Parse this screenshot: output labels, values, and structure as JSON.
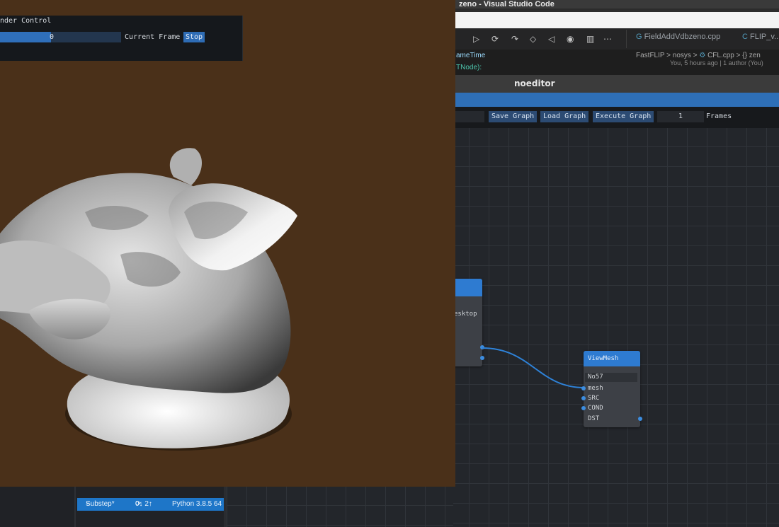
{
  "vscode": {
    "title": "zeno - Visual Studio Code",
    "tabs": [
      "FieldAddVdbzeno.cpp",
      "FLIP_v..."
    ],
    "tab_icons": [
      "cpp-file-icon",
      "c-file-icon"
    ],
    "breadcrumb": [
      "FastFLIP",
      "nosys",
      "CFL.cpp",
      "{} zen"
    ],
    "blame": "You, 5 hours ago | 1 author (You)",
    "code_fragments": [
      "ameTime",
      "TNode):"
    ]
  },
  "noeditor": {
    "title": "noeditor",
    "buttons": {
      "save": "Save Graph",
      "load": "Load Graph",
      "execute": "Execute Graph"
    },
    "frames_value": "1",
    "frames_label": "Frames"
  },
  "nodes": {
    "partial": {
      "output_label": "esktop"
    },
    "viewmesh": {
      "title": "ViewMesh",
      "name_field": "No57",
      "inputs": [
        "mesh",
        "SRC",
        "COND"
      ],
      "outputs": [
        "DST"
      ]
    }
  },
  "render_control": {
    "title": "nder Control",
    "frame_value": "0",
    "frame_progress": 0.42,
    "current_frame_label": "Current Frame",
    "stop_label": "Stop"
  },
  "statusbar": {
    "branch": "Substep*",
    "sync": "0↓ 2↑",
    "python": "Python 3.8.5 64"
  },
  "colors": {
    "viewport_bg": "#4a3019",
    "accent": "#2e7bd1",
    "grid_bg": "#23262b"
  }
}
